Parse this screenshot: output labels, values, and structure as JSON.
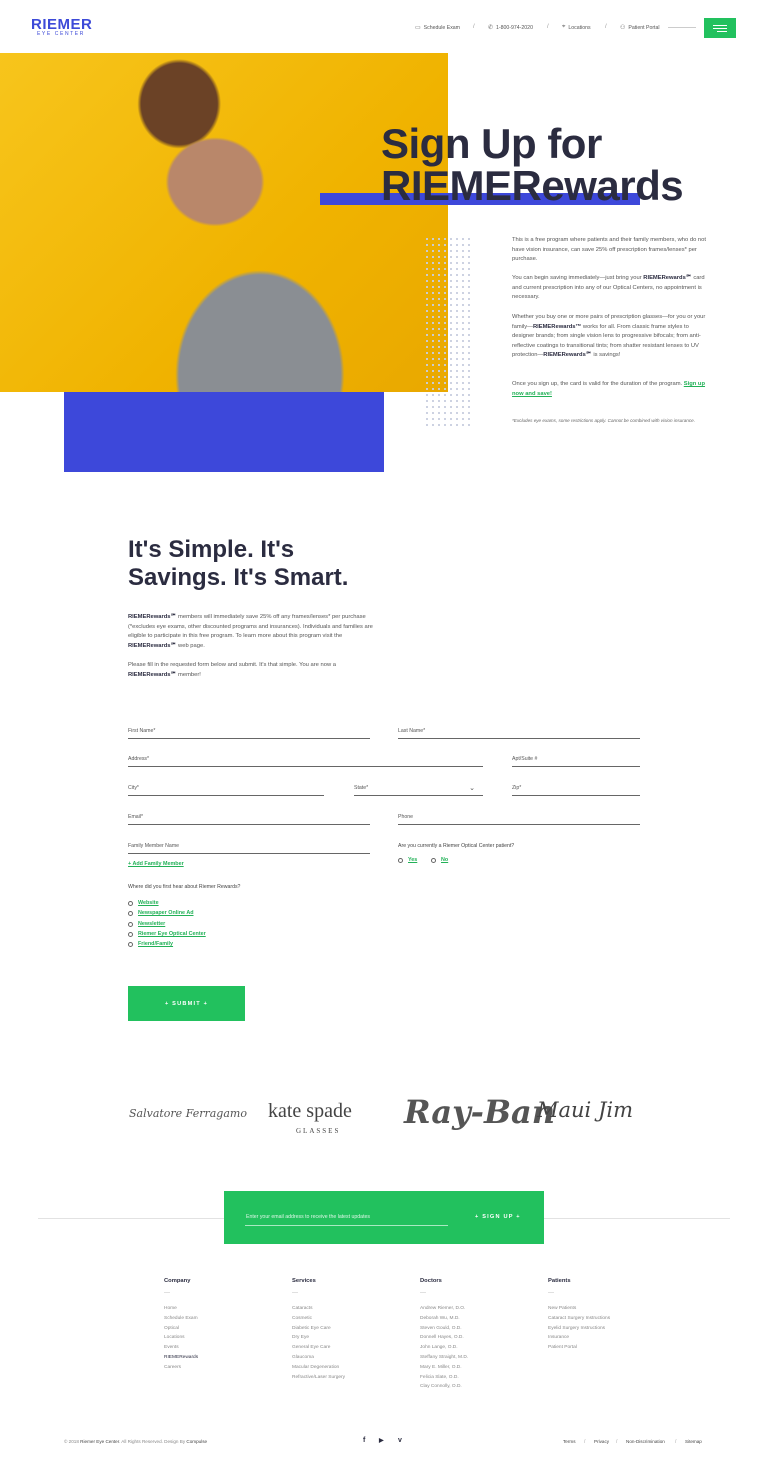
{
  "header": {
    "logo": "RIEMER",
    "logo_sub": "EYE CENTER",
    "nav": [
      {
        "label": "Schedule Exam",
        "icon": "calendar-icon"
      },
      {
        "label": "1-800-974-2020",
        "icon": "phone-icon"
      },
      {
        "label": "Locations",
        "icon": "location-pin-icon"
      },
      {
        "label": "Patient Portal",
        "icon": "user-icon"
      }
    ],
    "menu_icon": "hamburger-menu-icon"
  },
  "hero": {
    "title_line1": "Sign Up for",
    "title_line2": "RIEMERewards",
    "p1": "This is a free program where patients and their family members, who do not have vision insurance, can save 25% off prescription frames/lenses* per purchase.",
    "p2_before": "You can begin saving immediately—just bring your ",
    "p2_bold": "RIEMERewards℠",
    "p2_after": " card and current prescription into any of our Optical Centers, no appointment is necessary.",
    "p3_before": "Whether you buy one or more pairs of prescription glasses—for you or your family—",
    "p3_bold": "RIEMERewards™",
    "p3_middle": " works for all. From classic frame styles to designer brands; from single vision lens to progressive bifocals; from anti-reflective coatings to transitional tints; from shatter resistant lenses to UV protection—",
    "p3_bold2": "RIEMERewards℠",
    "p3_after": " is savings!",
    "p4": "Once you sign up, the card is valid for the duration of the program.",
    "p4_link": "Sign up now and save!",
    "note": "*Excludes eye exams, some restrictions apply. Cannot be combined with vision insurance."
  },
  "intro": {
    "title_line1": "It's Simple. It's",
    "title_line2": "Savings. It's Smart.",
    "p1_bold": "RIEMERewards℠",
    "p1_rest": " members will immediately save 25% off any frames/lenses* per purchase (*excludes eye exams, other discounted programs and insurances). Individuals and families are eligible to participate in this free program. To learn more about this program visit the ",
    "p1_bold2": "RIEMERewards℠",
    "p1_end": " web page.",
    "p2": "Please fill in the requested form below and submit. It's that simple. You are now a ",
    "p2_bold": "RIEMERewards℠",
    "p2_end": " member!"
  },
  "form": {
    "first_name": "First Name*",
    "last_name": "Last Name*",
    "address": "Address*",
    "apt": "Apt/Suite #",
    "city": "City*",
    "state": "State*",
    "zip": "Zip*",
    "email": "Email*",
    "phone": "Phone",
    "family": "Family Member Name",
    "add_family": "+ Add Family Member",
    "patient_q": "Are you currently a Riemer Optical Center patient?",
    "yes": "Yes",
    "no": "No",
    "hear_q": "Where did you first hear about Riemer Rewards?",
    "hear_options": [
      "Website",
      "Newspaper Online Ad",
      "Newsletter",
      "Riemer Eye Optical Center",
      "Friend/Family"
    ],
    "submit": "+ SUBMIT +"
  },
  "brands": {
    "b1": "Salvatore Ferragamo",
    "b2": "kate spade",
    "b2_sub": "GLASSES",
    "b3": "Ray-Ban",
    "b4": "Maui Jim"
  },
  "newsletter": {
    "placeholder": "Enter your email address to receive the latest updates",
    "button": "+ SIGN UP +"
  },
  "footer": {
    "dash": "—",
    "columns": [
      {
        "heading": "Company",
        "links": [
          "Home",
          "Schedule Exam",
          "Optical",
          "Locations",
          "Events",
          "RIEMERewards",
          "Careers"
        ]
      },
      {
        "heading": "Services",
        "links": [
          "Cataracts",
          "Cosmetic",
          "Diabetic Eye Care",
          "Dry Eye",
          "General Eye Care",
          "Glaucoma",
          "Macular Degeneration",
          "Refractive/Laser Surgery"
        ]
      },
      {
        "heading": "Doctors",
        "links": [
          "Andrew Riemer, D.O.",
          "Deborah Wu, M.D.",
          "Steven Gould, O.D.",
          "Donnell Hayes, O.D.",
          "John Lange, O.D.",
          "Steffany Straight, M.D.",
          "Mary E. Miller, O.D.",
          "Felicia Slate, O.D.",
          "Clay Connolly, O.D."
        ]
      },
      {
        "heading": "Patients",
        "links": [
          "New Patients",
          "Cataract Surgery Instructions",
          "Eyelid Surgery Instructions",
          "Insurance",
          "Patient Portal"
        ]
      }
    ],
    "copy_pre": "© 2018 ",
    "copy_company": "Riemer Eye Center",
    "copy_mid": ". All Rights Reserved. Design By ",
    "copy_design": "Compulse",
    "social": [
      "f",
      "▶",
      "v"
    ],
    "links": [
      "Terms",
      "Privacy",
      "Non-Discrimination",
      "Sitemap"
    ],
    "sep": "/"
  }
}
